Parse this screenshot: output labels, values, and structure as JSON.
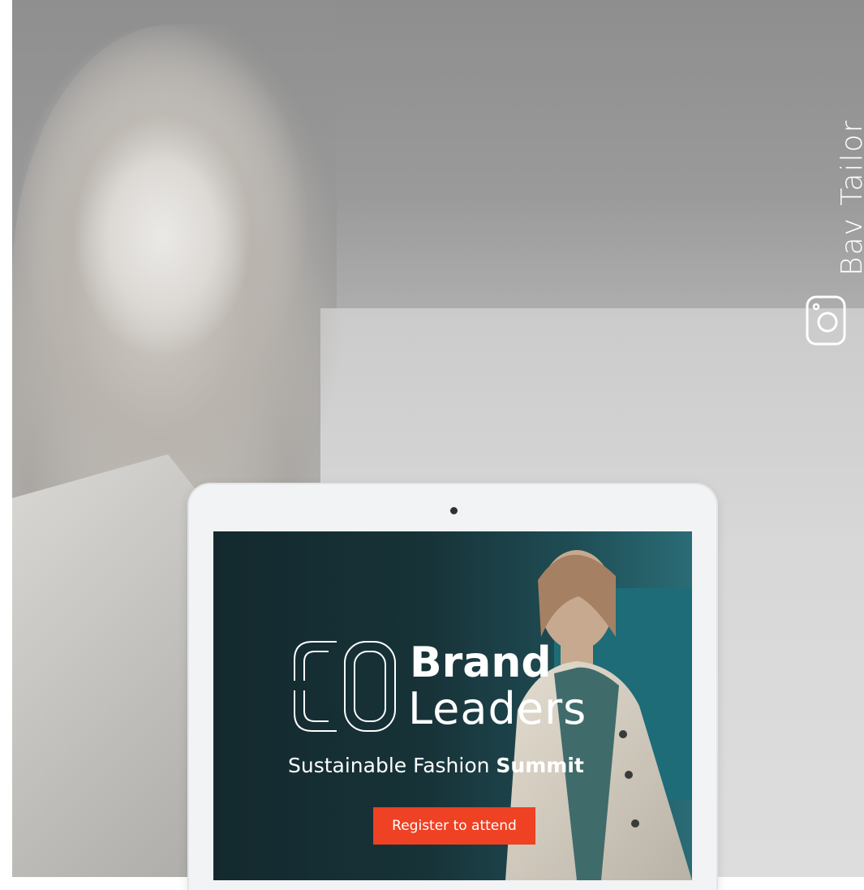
{
  "side_brand": {
    "name": "Bav Tailor",
    "icon": "instagram-icon"
  },
  "screen": {
    "logo_mark": "CO",
    "brand_line1": "Brand",
    "brand_line2": "Leaders",
    "subtitle_light": "Sustainable Fashion ",
    "subtitle_bold": "Summit",
    "cta_label": "Register to attend"
  },
  "colors": {
    "cta_background": "#ef4123",
    "screen_background": "#173338",
    "accent_teal": "#1d6c78",
    "device_frame": "#f2f3f5"
  }
}
